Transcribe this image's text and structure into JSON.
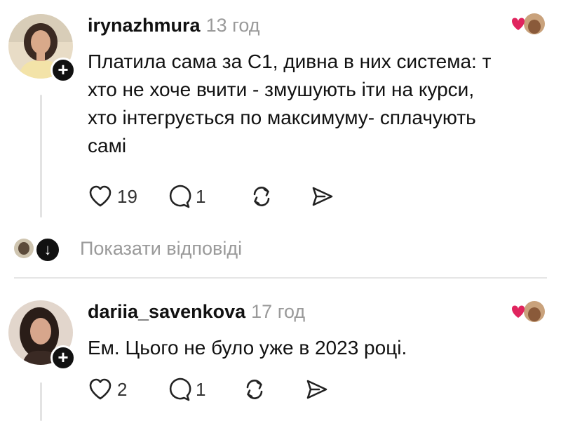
{
  "comments": [
    {
      "username": "irynazhmura",
      "time": "13 год",
      "text": "Платила сама за С1, дивна в них система: т\nхто не хоче вчити - змушують іти на курси, \nхто інтегрується по максимуму- сплачують\nсамі",
      "likes": "19",
      "replies": "1",
      "avatar_icon": "user-avatar",
      "follow_icon": "plus-icon",
      "liked_by_author_icon": "heart-avatar-icon"
    },
    {
      "username": "dariia_savenkova",
      "time": "17 год",
      "text": "Ем. Цього не було уже в 2023 році.",
      "likes": "2",
      "replies": "1",
      "avatar_icon": "user-avatar",
      "follow_icon": "plus-icon",
      "liked_by_author_icon": "heart-avatar-icon"
    }
  ],
  "show_replies": {
    "label": "Показати відповіді",
    "icon": "arrow-down-icon"
  },
  "colors": {
    "text": "#111111",
    "muted": "#9a9a9a",
    "heart": "#e0245e",
    "divider": "#e6e6e6"
  }
}
